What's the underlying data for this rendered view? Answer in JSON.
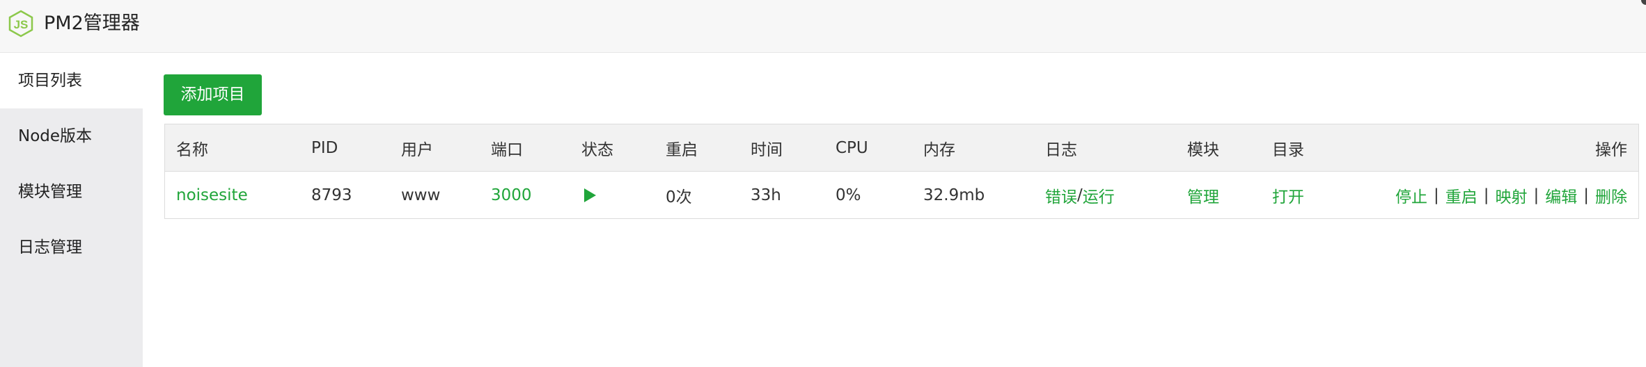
{
  "app": {
    "title": "PM2管理器",
    "logo_icon": "nodejs-icon",
    "accent_color": "#20a53a"
  },
  "sidebar": {
    "items": [
      {
        "label": "项目列表",
        "active": true
      },
      {
        "label": "Node版本",
        "active": false
      },
      {
        "label": "模块管理",
        "active": false
      },
      {
        "label": "日志管理",
        "active": false
      }
    ]
  },
  "toolbar": {
    "add_label": "添加项目"
  },
  "table": {
    "headers": {
      "name": "名称",
      "pid": "PID",
      "user": "用户",
      "port": "端口",
      "status": "状态",
      "restart": "重启",
      "time": "时间",
      "cpu": "CPU",
      "memory": "内存",
      "log": "日志",
      "module": "模块",
      "directory": "目录",
      "actions": "操作"
    },
    "rows": [
      {
        "name": "noisesite",
        "pid": "8793",
        "user": "www",
        "port": "3000",
        "status_icon": "play-icon",
        "restart": "0次",
        "time": "33h",
        "cpu": "0%",
        "memory": "32.9mb",
        "log_error": "错误",
        "log_sep": "/",
        "log_run": "运行",
        "module": "管理",
        "directory": "打开",
        "actions": {
          "stop": "停止",
          "restart": "重启",
          "map": "映射",
          "edit": "编辑",
          "delete": "删除",
          "sep": "|"
        }
      }
    ]
  }
}
